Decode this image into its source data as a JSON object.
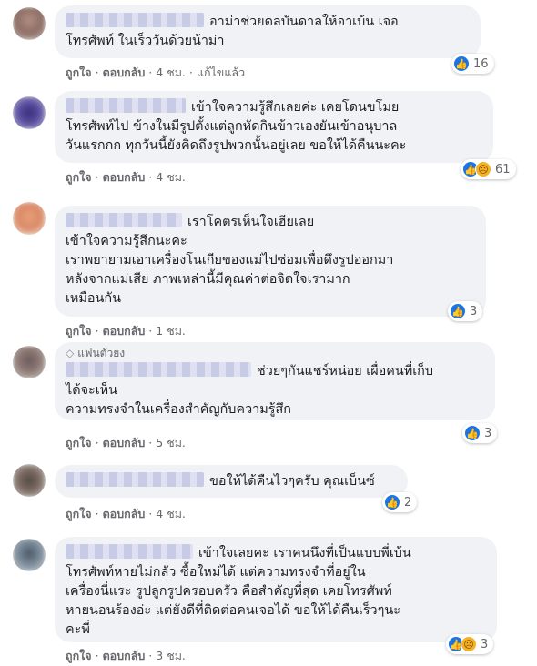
{
  "comments": [
    {
      "lines": [
        "อาม่าช่วยดลบันดาลให้อาเบ้น เจอ",
        "โทรศัพท์ ในเร็ววันด้วยน้าม่า"
      ],
      "actions": {
        "like": "ถูกใจ",
        "reply": "ตอบกลับ",
        "time": "4 ชม.",
        "edited": "แก้ไขแล้ว"
      },
      "reactions": {
        "types": [
          "like-icon"
        ],
        "count": "16"
      }
    },
    {
      "lines": [
        "เข้าใจความรู้สึกเลยค่ะ เคยโดนขโมย",
        "โทรศัพท์ไป ข้างในมีรูปตั้งแต่ลูกหัดกินข้าวเองยันเข้าอนุบาล",
        "วันแรกกก ทุกวันนี้ยังคิดถึงรูปพวกนั้นอยู่เลย ขอให้ได้คืนนะคะ"
      ],
      "actions": {
        "like": "ถูกใจ",
        "reply": "ตอบกลับ",
        "time": "4 ชม."
      },
      "reactions": {
        "types": [
          "like-icon",
          "sad-icon"
        ],
        "count": "61"
      }
    },
    {
      "lines": [
        "เราโคตรเห็นใจเฮียเลย",
        "เข้าใจความรู้สึกนะคะ",
        "เราพยายามเอาเครื่องโนเกียของแม่ไปซ่อมเพื่อดึงรูปออกมา",
        "หลังจากแม่เสีย ภาพเหล่านี้มีคุณค่าต่อจิตใจเรามาก",
        "เหมือนกัน"
      ],
      "actions": {
        "like": "ถูกใจ",
        "reply": "ตอบกลับ",
        "time": "1 ชม."
      },
      "reactions": {
        "types": [
          "like-icon"
        ],
        "count": "3"
      }
    },
    {
      "badge": "แฟนตัวยง",
      "lines": [
        "ช่วยๆกันแชร์หน่อย เผื่อคนที่เก็บ",
        "ได้จะเห็น",
        "ความทรงจำในเครื่องสำคัญกับความรู้สึก"
      ],
      "actions": {
        "like": "ถูกใจ",
        "reply": "ตอบกลับ",
        "time": "5 ชม."
      },
      "reactions": {
        "types": [
          "like-icon"
        ],
        "count": "3"
      }
    },
    {
      "lines": [
        "ขอให้ได้คืนไวๆครับ คุณเบ็นซ์"
      ],
      "actions": {
        "like": "ถูกใจ",
        "reply": "ตอบกลับ",
        "time": "4 ชม."
      },
      "reactions": {
        "types": [
          "like-icon"
        ],
        "count": "2"
      }
    },
    {
      "lines": [
        "เข้าใจเลยคะ เราคนนึงที่เป็นแบบพี่เบ้น",
        "โทรศัพท์หายไม่กลัว ซื้อใหม่ได้ แต่ความทรงจำที่อยู่ใน",
        "เครื่องนี่แระ รูปลูกรูปครอบครัว คือสำคัญที่สุด เคยโทรศัพท์",
        "หายนอนร้องอ่ะ แต่ยังดีที่ติดต่อคนเจอได้ ขอให้ได้คืนเร็วๆนะ",
        "คะพี่"
      ],
      "actions": {
        "like": "ถูกใจ",
        "reply": "ตอบกลับ",
        "time": "3 ชม."
      },
      "reactions": {
        "types": [
          "like-icon",
          "sad-icon"
        ],
        "count": "3"
      }
    }
  ]
}
